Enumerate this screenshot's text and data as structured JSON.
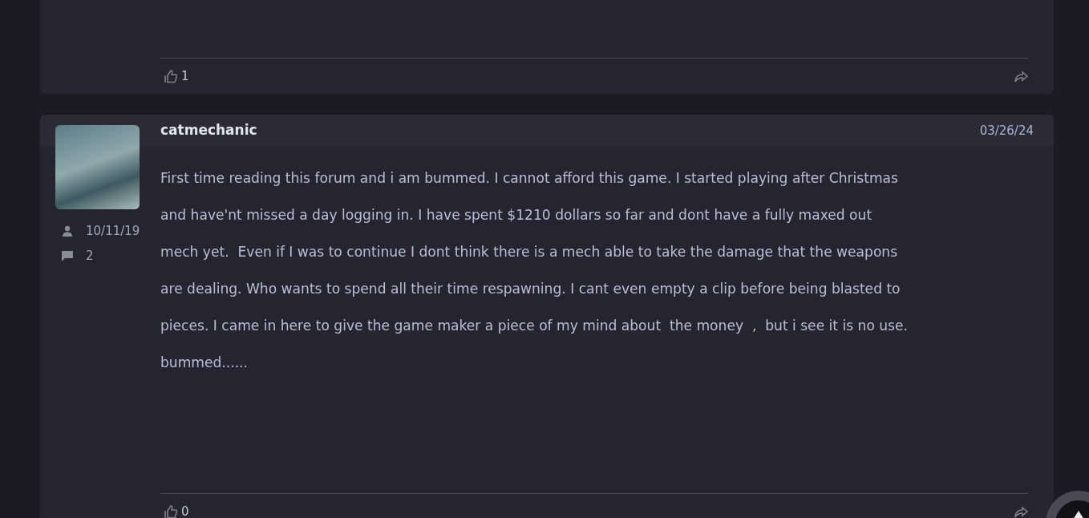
{
  "posts": [
    {
      "likes": "1"
    },
    {
      "author": "catmechanic",
      "date": "03/26/24",
      "joined": "10/11/19",
      "post_count": "2",
      "body_lines": [
        "First time reading this forum and i am bummed. I cannot afford this game. I started playing after Christmas",
        "and have'nt missed a day logging in. I have spent $1210 dollars so far and dont have a fully maxed out",
        "mech yet.  Even if I was to continue I dont think there is a mech able to take the damage that the weapons",
        "are dealing. Who wants to spend all their time respawning. I cant even empty a clip before being blasted to",
        "pieces. I came in here to give the game maker a piece of my mind about  the money  ,  but i see it is no use.",
        "bummed......"
      ],
      "likes": "0"
    }
  ]
}
